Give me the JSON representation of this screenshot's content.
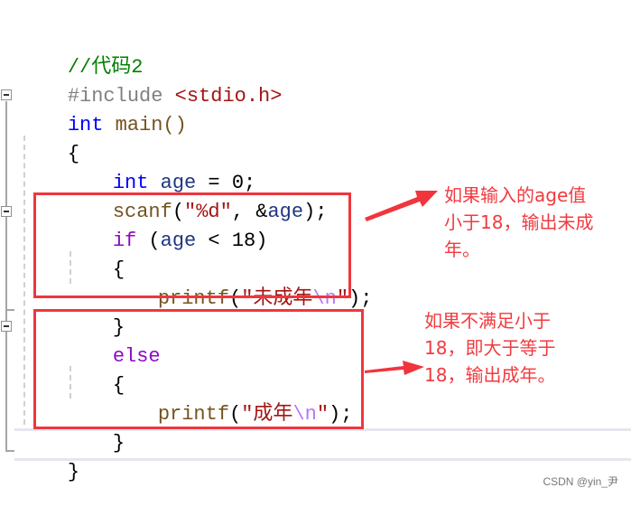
{
  "code": {
    "line1": {
      "comment": "//代码2"
    },
    "line2": {
      "directive": "#include",
      "header": "<stdio.h>"
    },
    "line3": {
      "type": "int",
      "rest": " main()"
    },
    "line4": {
      "brace": "{"
    },
    "line5": {
      "type": "int",
      "var": "age",
      "rest": " = 0;"
    },
    "line6": {
      "fn": "scanf",
      "p1": "(",
      "str": "\"%d\"",
      "p2": ", &",
      "var": "age",
      "p3": ");"
    },
    "line7": {
      "kw": "if",
      "p1": " (",
      "var": "age",
      "rest": " < 18)"
    },
    "line8": {
      "brace": "{"
    },
    "line9": {
      "fn": "printf",
      "p1": "(",
      "str": "\"未成年",
      "esc": "\\n",
      "strend": "\"",
      "p2": ");"
    },
    "line10": {
      "brace": "}"
    },
    "line11": {
      "kw": "else"
    },
    "line12": {
      "brace": "{"
    },
    "line13": {
      "fn": "printf",
      "p1": "(",
      "str": "\"成年",
      "esc": "\\n",
      "strend": "\"",
      "p2": ");"
    },
    "line14": {
      "brace": "}"
    },
    "line15": {
      "brace": "}"
    }
  },
  "annotations": {
    "if_note": [
      "如果输入的age值",
      "小于18，输出未成",
      "年。"
    ],
    "else_note": [
      "如果不满足小于",
      "18，即大于等于",
      "18，输出成年。"
    ],
    "color": "#f23a3f"
  },
  "watermark": "CSDN @yin_尹"
}
